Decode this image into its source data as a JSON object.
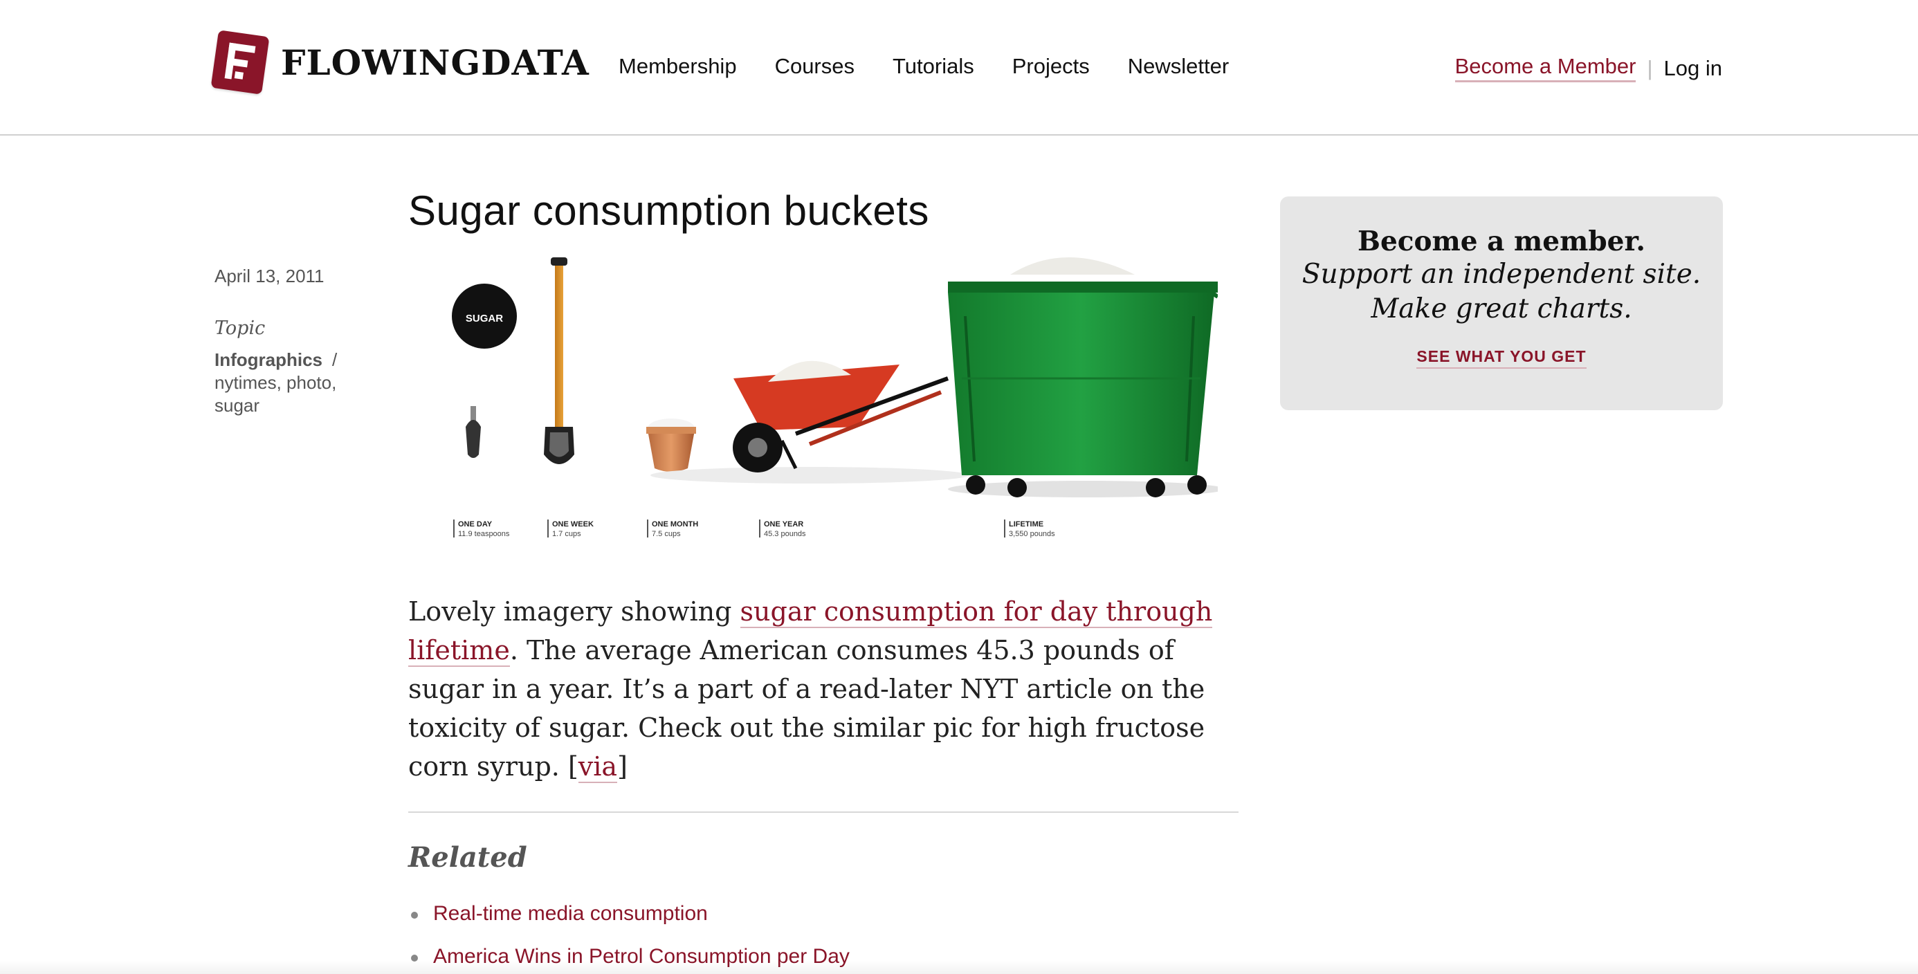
{
  "header": {
    "logo_text": "FLOWINGDATA",
    "nav": [
      {
        "label": "Membership"
      },
      {
        "label": "Courses"
      },
      {
        "label": "Tutorials"
      },
      {
        "label": "Projects"
      },
      {
        "label": "Newsletter"
      }
    ],
    "become_member": "Become a Member",
    "separator": "|",
    "login": "Log in"
  },
  "meta": {
    "date": "April 13, 2011",
    "topic_label": "Topic",
    "category": "Infographics",
    "slash": "/",
    "tags": [
      "nytimes",
      "photo",
      "sugar"
    ],
    "tag_sep": ", "
  },
  "article": {
    "title": "Sugar consumption buckets",
    "body_text_1": "Lovely imagery showing ",
    "body_link": "sugar consumption for day through lifetime",
    "body_text_2": ". The average American consumes 45.3 pounds of sugar in a year. It’s a part of a read-later NYT article on the toxicity of sugar. Check out the similar pic for high fructose corn syrup. [",
    "via_link": "via",
    "body_text_3": "]"
  },
  "image": {
    "bowl_label": "SUGAR",
    "captions": [
      {
        "period": "ONE DAY",
        "amount": "11.9 teaspoons"
      },
      {
        "period": "ONE WEEK",
        "amount": "1.7 cups"
      },
      {
        "period": "ONE MONTH",
        "amount": "7.5 cups"
      },
      {
        "period": "ONE YEAR",
        "amount": "45.3 pounds"
      },
      {
        "period": "LIFETIME",
        "amount": "3,550 pounds"
      }
    ]
  },
  "related": {
    "title": "Related",
    "items": [
      {
        "label": "Real-time media consumption"
      },
      {
        "label": "America Wins in Petrol Consumption per Day"
      }
    ]
  },
  "sidebar": {
    "headline": "Become a member.",
    "tagline_1": "Support an independent site.",
    "tagline_2": "Make great charts.",
    "cta": "SEE WHAT YOU GET"
  },
  "colors": {
    "accent": "#8a1529",
    "dumpster": "#1f8a3a",
    "wheelbarrow": "#d63a22"
  }
}
